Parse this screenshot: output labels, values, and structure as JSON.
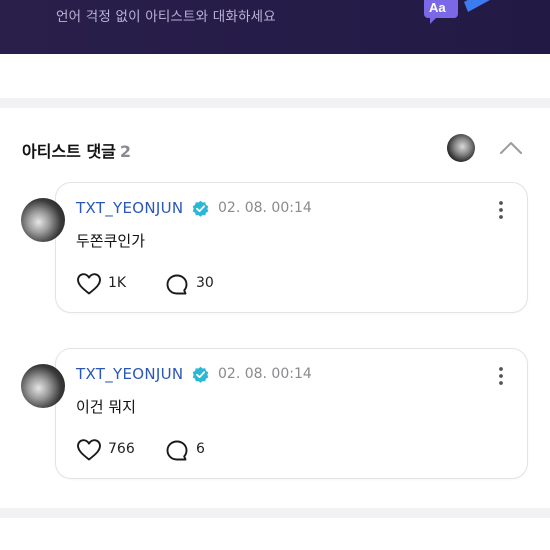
{
  "banner": {
    "text": "언어 걱정 없이 아티스트와 대화하세요",
    "translate_label": "Aa"
  },
  "section": {
    "title": "아티스트 댓글",
    "count": "2"
  },
  "comments": [
    {
      "author": "TXT_YEONJUN",
      "time": "02. 08. 00:14",
      "text": "두쫀쿠인가",
      "likes": "1K",
      "replies": "30"
    },
    {
      "author": "TXT_YEONJUN",
      "time": "02. 08. 00:14",
      "text": "이건 뭐지",
      "likes": "766",
      "replies": "6"
    }
  ],
  "colors": {
    "banner_bg": "#261c49",
    "author_name": "#2a57b8",
    "verified_badge": "#2bb8d6",
    "muted_text": "#8a8a8f"
  },
  "icons": {
    "verified": "verified-badge-icon",
    "more": "more-vertical-icon",
    "like": "heart-icon",
    "reply": "speech-bubble-icon",
    "collapse": "chevron-up-icon",
    "translate": "translate-icon"
  }
}
